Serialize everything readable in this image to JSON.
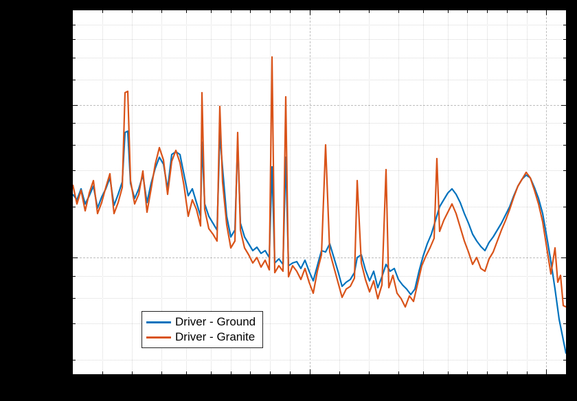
{
  "chart_data": {
    "type": "line",
    "title": "",
    "xlabel": "",
    "ylabel": "",
    "x_scale": "log",
    "y_scale": "log",
    "legend_position": "lower-left",
    "grid": true,
    "series": [
      {
        "name": "Driver - Ground",
        "color": "#0072BD"
      },
      {
        "name": "Driver - Granite",
        "color": "#D95319"
      }
    ],
    "comment": "Noisy PSD-style spectra on log-log axes; two traces largely overlap, with Granite showing tall narrow spikes at several discrete frequencies in the lower half of the band, and Ground slightly higher in parts of the upper band. Axis tick labels are not visible in the source image so numeric ranges are not recoverable."
  },
  "legend": {
    "items": [
      {
        "label": "Driver - Ground"
      },
      {
        "label": "Driver - Granite"
      }
    ]
  }
}
